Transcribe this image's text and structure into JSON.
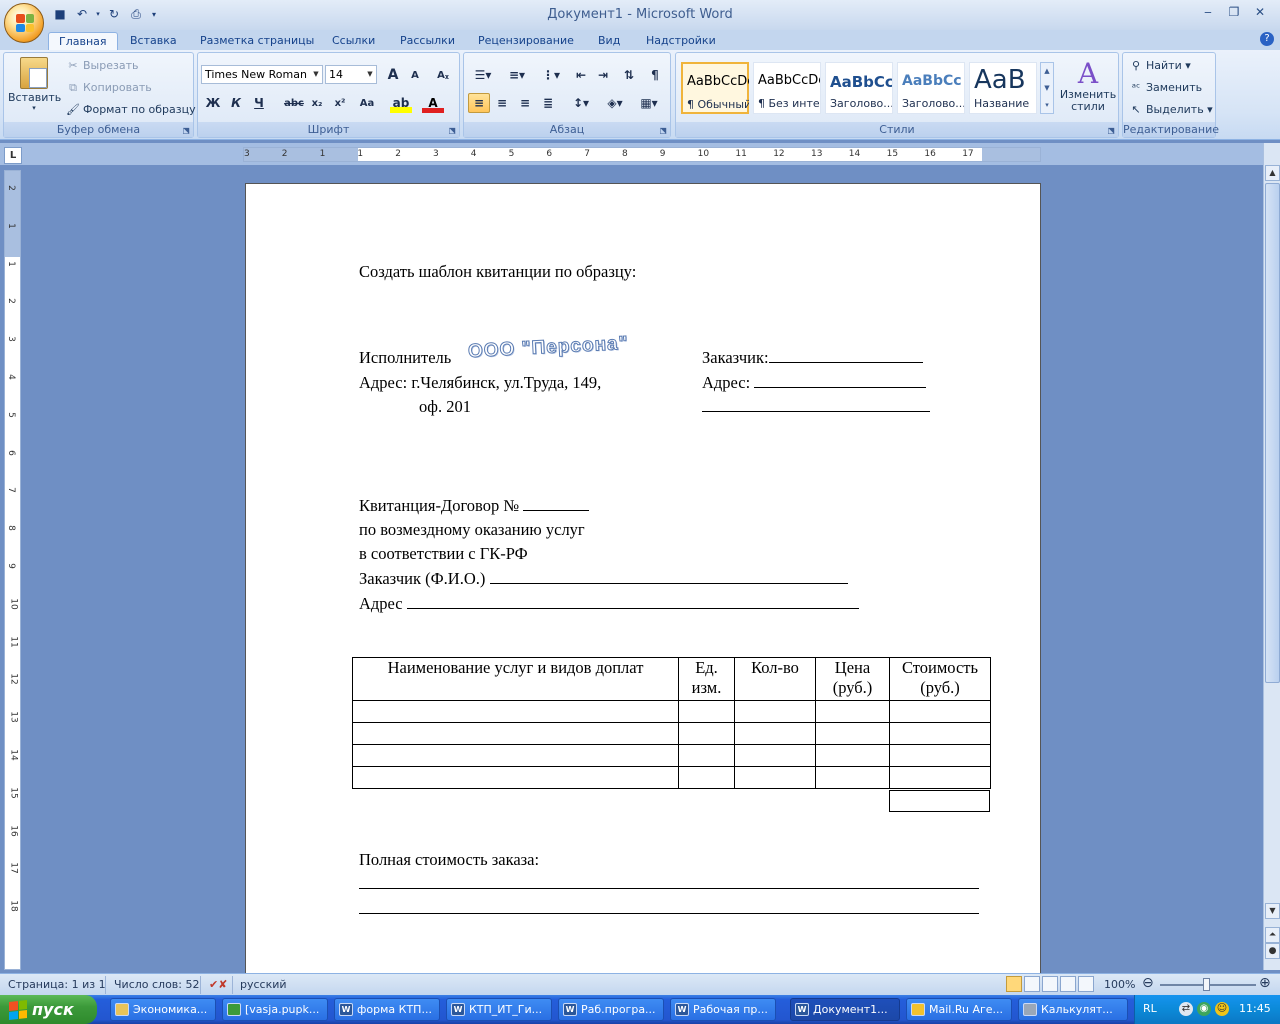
{
  "window": {
    "title": "Документ1 - Microsoft Word"
  },
  "tabs": [
    "Главная",
    "Вставка",
    "Разметка страницы",
    "Ссылки",
    "Рассылки",
    "Рецензирование",
    "Вид",
    "Надстройки"
  ],
  "clipboard": {
    "paste": "Вставить",
    "cut": "Вырезать",
    "copy": "Копировать",
    "format": "Формат по образцу",
    "label": "Буфер обмена"
  },
  "font": {
    "name": "Times New Roman",
    "size": "14",
    "label": "Шрифт",
    "bold": "Ж",
    "italic": "К",
    "underline": "Ч",
    "strike": "abc",
    "sub": "x₂",
    "sup": "x²",
    "case": "Aa",
    "grow": "A",
    "shrink": "A"
  },
  "paragraph": {
    "label": "Абзац"
  },
  "styles": {
    "label": "Стили",
    "items": [
      {
        "preview": "AaBbCcDc",
        "name": "¶ Обычный"
      },
      {
        "preview": "AaBbCcDc",
        "name": "¶ Без инте..."
      },
      {
        "preview": "AaBbCc",
        "name": "Заголово..."
      },
      {
        "preview": "AaBbCc",
        "name": "Заголово..."
      },
      {
        "preview": "AaB",
        "name": "Название"
      }
    ],
    "change": "Изменить стили"
  },
  "editing": {
    "label": "Редактирование",
    "find": "Найти",
    "replace": "Заменить",
    "select": "Выделить"
  },
  "ruler": {
    "h": [
      "3",
      "2",
      "1",
      "1",
      "2",
      "3",
      "4",
      "5",
      "6",
      "7",
      "8",
      "9",
      "10",
      "11",
      "12",
      "13",
      "14",
      "15",
      "16",
      "17"
    ],
    "v": [
      "2",
      "1",
      "1",
      "2",
      "3",
      "4",
      "5",
      "6",
      "7",
      "8",
      "9",
      "10",
      "11",
      "12",
      "13",
      "14",
      "15",
      "16",
      "17",
      "18"
    ]
  },
  "document": {
    "heading": "Создать шаблон квитанции по образцу:",
    "executor_label": "Исполнитель",
    "wordart": "ООО \"Персона\"",
    "customer_label": "Заказчик:",
    "address1": "Адрес: г.Челябинск, ул.Труда, 149,",
    "address1b": "оф. 201",
    "address_right": "Адрес:",
    "receipt_lines": [
      "Квитанция-Договор №",
      "по возмездному оказанию услуг",
      "в соответствии с ГК-РФ",
      "Заказчик (Ф.И.О.)",
      "Адрес"
    ],
    "table_headers": [
      "Наименование услуг и видов доплат",
      "Ед. изм.",
      "Кол-во",
      "Цена (руб.)",
      "Стоимость (руб.)"
    ],
    "total_label": "Полная стоимость заказа:"
  },
  "status": {
    "page": "Страница: 1 из 1",
    "words": "Число слов: 52",
    "lang": "русский",
    "zoom": "100%"
  },
  "taskbar": {
    "start": "пуск",
    "tasks": [
      "Экономика...",
      "[vasja.pupk...",
      "форма КТП...",
      "КТП_ИТ_Ги...",
      "Раб.програ...",
      "Рабочая пр...",
      "Документ1...",
      "Mail.Ru Аге...",
      "Калькулят..."
    ],
    "lang": "RL",
    "clock": "11:45"
  }
}
